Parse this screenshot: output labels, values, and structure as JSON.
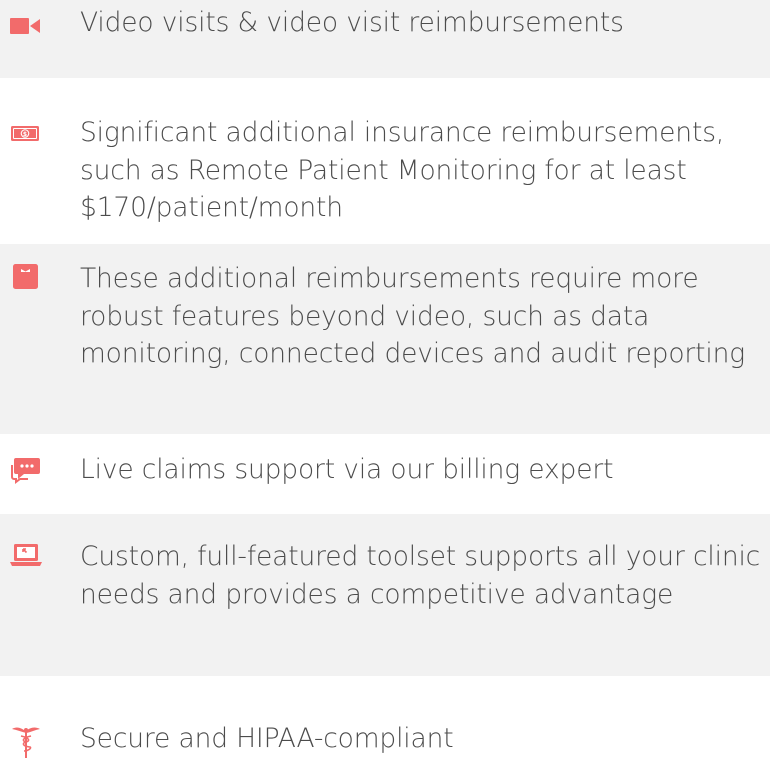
{
  "accent_color": "#f26b6b",
  "features": [
    {
      "icon": "video-camera-icon",
      "text": "Video visits & video visit reimbursements"
    },
    {
      "icon": "money-icon",
      "text": "Significant additional insurance reimbursements, such as Remote Patient Monitoring for at least $170/patient/month"
    },
    {
      "icon": "scale-icon",
      "text": "These additional reimbursements require more robust features beyond video, such as data monitoring, connected devices and audit reporting"
    },
    {
      "icon": "chat-icon",
      "text": "Live claims support via our billing expert"
    },
    {
      "icon": "laptop-icon",
      "text": "Custom, full-featured toolset supports all your clinic needs and provides a competitive advantage"
    },
    {
      "icon": "caduceus-icon",
      "text": "Secure and HIPAA-compliant"
    }
  ]
}
